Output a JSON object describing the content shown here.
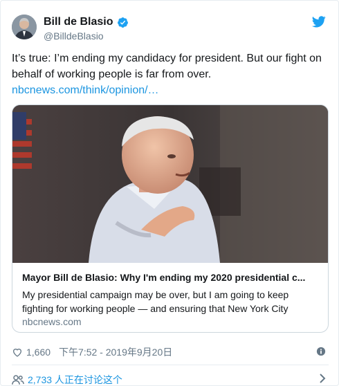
{
  "user": {
    "name": "Bill de Blasio",
    "handle": "@BilldeBlasio"
  },
  "tweet": {
    "text": "It’s true: I’m ending my candidacy for president. But our fight on behalf of working people is far from over.",
    "link_text": "nbcnews.com/think/opinion/…"
  },
  "card": {
    "title": "Mayor Bill de Blasio: Why I'm ending my 2020 presidential c...",
    "description": "My presidential campaign may be over, but I am going to keep fighting for working people — and ensuring that New York City",
    "domain": "nbcnews.com"
  },
  "meta": {
    "likes": "1,660",
    "timestamp": "下午7:52 - 2019年9月20日"
  },
  "discussion": {
    "text": "2,733 人正在讨论这个"
  },
  "colors": {
    "link": "#1b95e0",
    "secondary": "#657786",
    "border": "#e6ecf0",
    "verified": "#1da1f2"
  },
  "icons": [
    "verified-badge-icon",
    "twitter-bird-icon",
    "heart-icon",
    "info-icon",
    "people-icon",
    "chevron-right-icon"
  ]
}
